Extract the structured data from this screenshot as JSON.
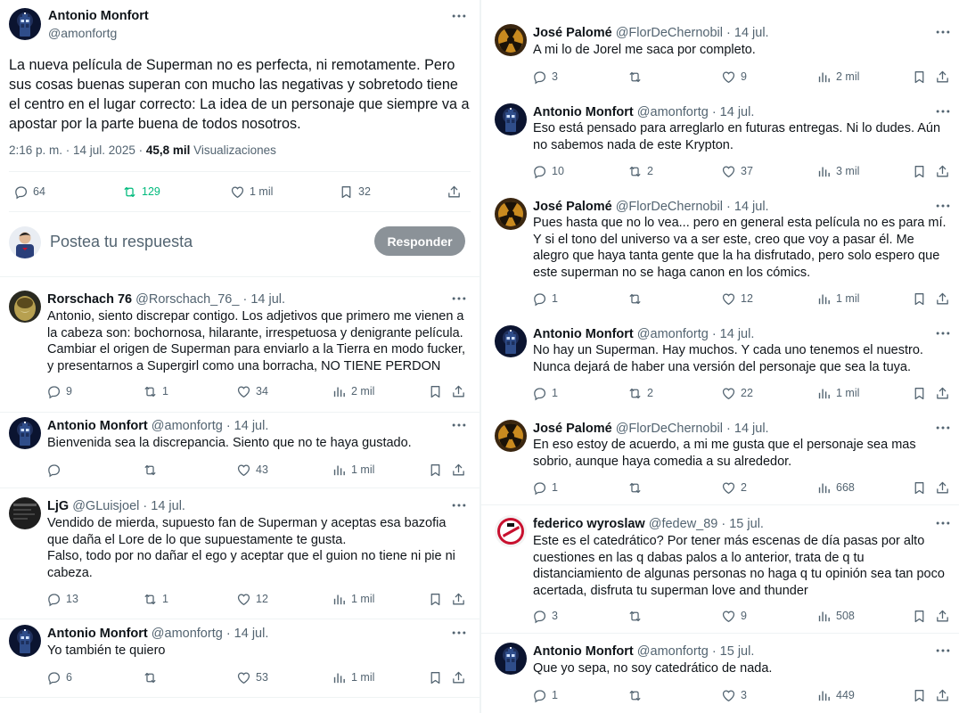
{
  "main_tweet": {
    "author_name": "Antonio Monfort",
    "author_handle": "@amonfortg",
    "text": "La nueva película de Superman no es perfecta, ni remotamente. Pero sus cosas buenas superan con mucho las negativas y sobretodo tiene el centro en el lugar correcto:  La idea de un personaje que siempre va a apostar por la parte buena de todos nosotros.",
    "time": "2:16 p. m. · 14 jul. 2025 · ",
    "views_count": "45,8 mil",
    "views_label": " Visualizaciones",
    "replies": "64",
    "retweets": "129",
    "likes": "1 mil",
    "bookmarks": "32"
  },
  "composer": {
    "placeholder": "Postea tu respuesta",
    "button_label": "Responder"
  },
  "left_replies": [
    {
      "name": "Rorschach 76",
      "handle": "@Rorschach_76_",
      "date": " · 14 jul.",
      "text": "Antonio, siento discrepar contigo. Los adjetivos que primero me vienen a la cabeza son: bochornosa, hilarante, irrespetuosa y denigrante película.\nCambiar el origen de Superman para enviarlo a la Tierra en modo fucker, y presentarnos a Supergirl como una borracha, NO TIENE PERDON",
      "replies": "9",
      "retweets": "1",
      "likes": "34",
      "views": "2 mil"
    },
    {
      "name": "Antonio Monfort",
      "handle": "@amonfortg",
      "date": " · 14 jul.",
      "text": "Bienvenida sea la discrepancia. Siento que no te haya gustado.",
      "replies": "",
      "retweets": "",
      "likes": "43",
      "views": "1 mil"
    },
    {
      "name": "LjG",
      "handle": "@GLuisjoel",
      "date": " · 14 jul.",
      "text": "Vendido de mierda, supuesto fan de Superman y aceptas esa bazofia que daña el Lore de lo que supuestamente te gusta.\nFalso, todo por no dañar el ego y aceptar que el guion no tiene ni pie ni cabeza.",
      "replies": "13",
      "retweets": "1",
      "likes": "12",
      "views": "1 mil"
    },
    {
      "name": "Antonio Monfort",
      "handle": "@amonfortg",
      "date": " · 14 jul.",
      "text": "Yo también te quiero",
      "replies": "6",
      "retweets": "",
      "likes": "53",
      "views": "1 mil"
    }
  ],
  "right_replies": [
    {
      "name": "José Palomé",
      "handle": "@FlorDeChernobil",
      "date": " · 14 jul.",
      "text": "A mi lo de Jorel me saca por completo.",
      "replies": "3",
      "retweets": "",
      "likes": "9",
      "views": "2 mil"
    },
    {
      "name": "Antonio Monfort",
      "handle": "@amonfortg",
      "date": " · 14 jul.",
      "text": "Eso está pensado para arreglarlo en futuras entregas. Ni lo dudes. Aún no sabemos nada de este Krypton.",
      "replies": "10",
      "retweets": "2",
      "likes": "37",
      "views": "3 mil"
    },
    {
      "name": "José Palomé",
      "handle": "@FlorDeChernobil",
      "date": " · 14 jul.",
      "text": "Pues hasta que no lo vea... pero en general esta película no es para mí. Y si el tono del universo va a ser este, creo que voy a pasar él. Me alegro que haya tanta gente que la ha disfrutado,  pero solo espero que este superman no se haga canon en los cómics.",
      "replies": "1",
      "retweets": "",
      "likes": "12",
      "views": "1 mil"
    },
    {
      "name": "Antonio Monfort",
      "handle": "@amonfortg",
      "date": " · 14 jul.",
      "text": "No hay un Superman. Hay muchos. Y cada uno tenemos el nuestro. Nunca dejará de haber una versión del personaje que sea la tuya.",
      "replies": "1",
      "retweets": "2",
      "likes": "22",
      "views": "1 mil"
    },
    {
      "name": "José Palomé",
      "handle": "@FlorDeChernobil",
      "date": " · 14 jul.",
      "text": "En eso estoy de acuerdo,  a mi me gusta que el personaje sea mas sobrio, aunque haya comedia a su alrededor.",
      "replies": "1",
      "retweets": "",
      "likes": "2",
      "views": "668"
    },
    {
      "name": "federico wyroslaw",
      "handle": "@fedew_89",
      "date": " · 15 jul.",
      "text": "Este es el catedrático? Por tener más escenas de día pasas por alto cuestiones en las q dabas palos a lo anterior, trata de q tu distanciamiento de algunas personas no haga q tu opinión sea tan poco acertada, disfruta tu superman love and thunder",
      "replies": "3",
      "retweets": "",
      "likes": "9",
      "views": "508"
    },
    {
      "name": "Antonio Monfort",
      "handle": "@amonfortg",
      "date": " · 15 jul.",
      "text": "Que yo sepa, no soy catedrático de nada.",
      "replies": "1",
      "retweets": "",
      "likes": "3",
      "views": "449"
    }
  ],
  "colors": {
    "text": "#0f1419",
    "muted": "#536471",
    "retweet_active": "#00ba7c",
    "divider": "#eff3f4",
    "button_disabled": "#8b9298"
  },
  "icons": [
    "reply-icon",
    "retweet-icon",
    "like-icon",
    "views-icon",
    "bookmark-icon",
    "share-icon",
    "more-icon"
  ]
}
